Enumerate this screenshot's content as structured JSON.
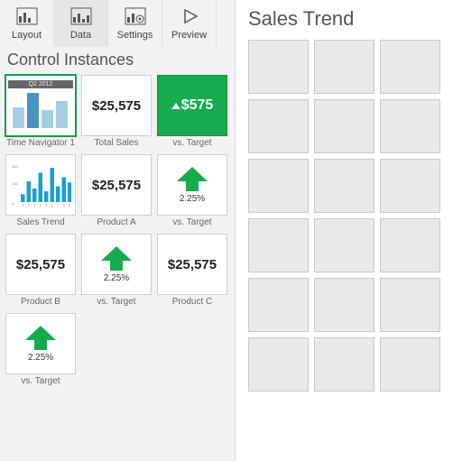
{
  "toolbar": {
    "tabs": [
      {
        "id": "layout",
        "label": "Layout",
        "active": false
      },
      {
        "id": "data",
        "label": "Data",
        "active": true
      },
      {
        "id": "settings",
        "label": "Settings",
        "active": false
      },
      {
        "id": "preview",
        "label": "Preview",
        "active": false
      }
    ]
  },
  "section_title": "Control Instances",
  "tiles": [
    {
      "kind": "timenav",
      "caption": "Time Navigator 1",
      "header": "Q2 2012",
      "selected": true
    },
    {
      "kind": "value",
      "caption": "Total Sales",
      "value": "$25,575"
    },
    {
      "kind": "delta",
      "caption": "vs. Target",
      "value": "$575"
    },
    {
      "kind": "bars",
      "caption": "Sales Trend",
      "bars": [
        22,
        58,
        38,
        82,
        30,
        96,
        44,
        70,
        55,
        90
      ]
    },
    {
      "kind": "value",
      "caption": "Product A",
      "value": "$25,575"
    },
    {
      "kind": "arrow",
      "caption": "vs. Target",
      "pct": "2.25%"
    },
    {
      "kind": "value",
      "caption": "Product B",
      "value": "$25,575"
    },
    {
      "kind": "arrow",
      "caption": "vs. Target",
      "pct": "2.25%"
    },
    {
      "kind": "value",
      "caption": "Product C",
      "value": "$25,575"
    },
    {
      "kind": "arrow",
      "caption": "vs. Target",
      "pct": "2.25%"
    }
  ],
  "preview": {
    "title": "Sales Trend",
    "rows": 6,
    "cols": 3
  },
  "colors": {
    "accent": "#17ab4f",
    "bar": "#1a9fd4"
  }
}
